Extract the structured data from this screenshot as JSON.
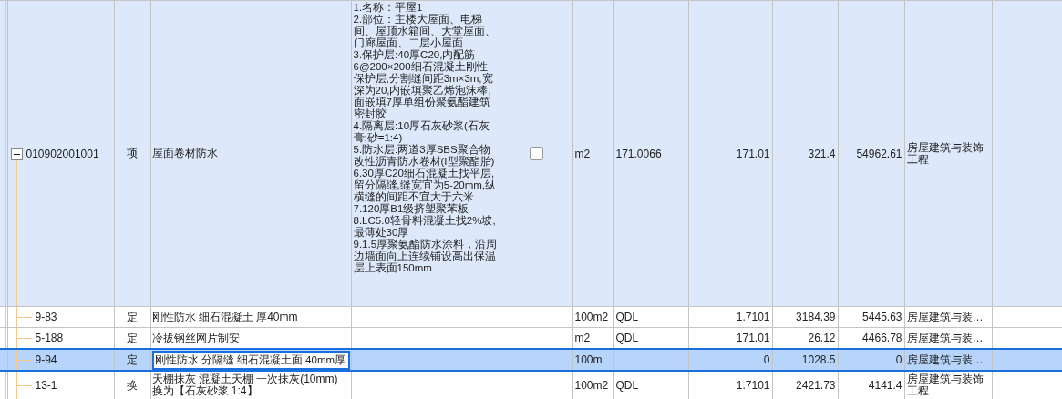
{
  "table": {
    "rows": [
      {
        "code": "010902001001",
        "type": "项",
        "name": "屋面卷材防水",
        "features": [
          "1.名称：平屋1",
          "2.部位：主楼大屋面、电梯间、屋顶水箱间、大堂屋面、门廊屋面、二层小屋面",
          "3.保护层:40厚C20,内配筋6@200×200细石混凝土刚性保护层,分割缝间距3m×3m,宽深为20,内嵌填聚乙烯泡沫棒,面嵌填7厚单组份聚氨酯建筑密封胶",
          "4.隔离层:10厚石灰砂浆(石灰膏:砂=1:4)",
          "5.防水层:两道3厚SBS聚合物改性沥青防水卷材(I型聚酯胎)",
          "6.30厚C20细石混凝土找平层,留分隔缝,缝宽宜为5-20mm,纵横缝的间距不宜大于六米",
          "7.120厚B1级挤塑聚苯板",
          "8.LC5.0轻骨料混凝土找2%坡,最薄处30厚",
          "9.1.5厚聚氨酯防水涂料，沿周边墙面向上连续铺设高出保温层上表面150mm"
        ],
        "checked": false,
        "unit": "m2",
        "formula": "171.0066",
        "quantity": "171.01",
        "price": "321.4",
        "total": "54962.61",
        "specialty": "房屋建筑与装饰工程",
        "expanded": true,
        "selected": false,
        "children": [
          {
            "code": "9-83",
            "type": "定",
            "name": "刚性防水 细石混凝土 厚40mm",
            "unit": "100m2",
            "formula": "QDL",
            "quantity": "1.7101",
            "price": "3184.39",
            "total": "5445.63",
            "specialty": "房屋建筑与装…",
            "selected": false,
            "editing": false
          },
          {
            "code": "5-188",
            "type": "定",
            "name": "冷拔钢丝网片制安",
            "unit": "m2",
            "formula": "QDL",
            "quantity": "171.01",
            "price": "26.12",
            "total": "4466.78",
            "specialty": "房屋建筑与装…",
            "selected": false,
            "editing": false
          },
          {
            "code": "9-94",
            "type": "定",
            "name": "刚性防水 分隔缝 细石混凝土面 40mm厚",
            "unit": "100m",
            "quantity": "0",
            "price": "1028.5",
            "total": "0",
            "specialty": "房屋建筑与装…",
            "selected": true,
            "editing": true
          },
          {
            "code": "13-1",
            "type": "换",
            "name": "天棚抹灰 混凝土天棚 一次抹灰(10mm) 换为【石灰砂浆 1:4】",
            "unit": "100m2",
            "formula": "QDL",
            "quantity": "1.7101",
            "price": "2421.73",
            "total": "4141.4",
            "specialty": "房屋建筑与装饰工程",
            "selected": false,
            "editing": false
          }
        ]
      }
    ]
  }
}
